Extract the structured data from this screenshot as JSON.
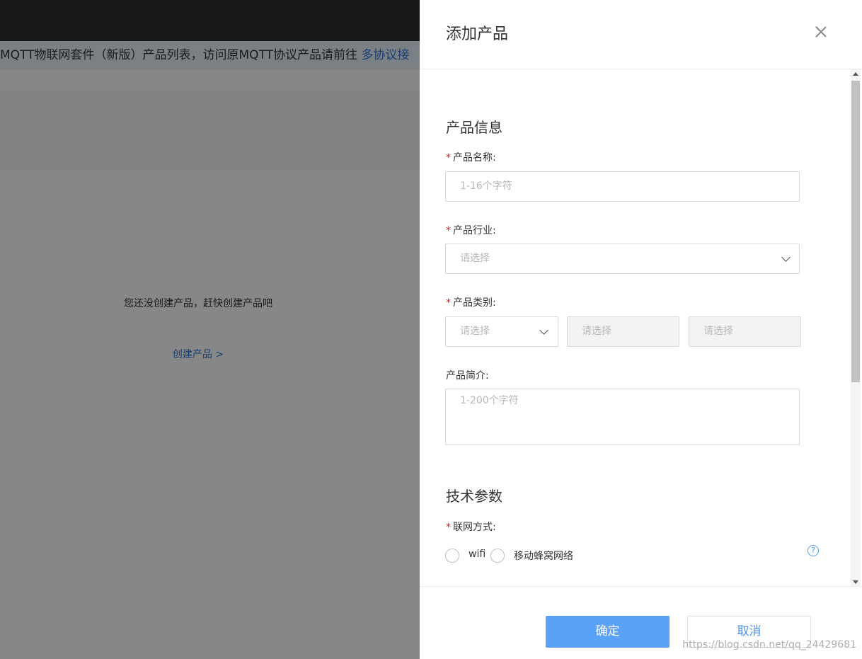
{
  "background": {
    "notice_text": "MQTT物联网套件（新版）产品列表，访问原MQTT协议产品请前往 ",
    "notice_link": "多协议接",
    "empty_text": "您还没创建产品，赶快创建产品吧",
    "create_link": "创建产品 >"
  },
  "drawer": {
    "title": "添加产品",
    "sections": {
      "info_title": "产品信息",
      "tech_title": "技术参数"
    },
    "fields": {
      "name_label": "产品名称:",
      "name_placeholder": "1-16个字符",
      "industry_label": "产品行业:",
      "industry_placeholder": "请选择",
      "category_label": "产品类别:",
      "category_placeholders": [
        "请选择",
        "请选择",
        "请选择"
      ],
      "intro_label": "产品简介:",
      "intro_placeholder": "1-200个字符",
      "network_label": "联网方式:",
      "network_options": [
        "wifi",
        "移动蜂窝网络"
      ]
    },
    "required_mark": "*",
    "help_icon_glyph": "?",
    "buttons": {
      "confirm": "确定",
      "cancel": "取消"
    }
  },
  "watermark": "https://blog.csdn.net/qq_24429681",
  "colors": {
    "accent": "#5aa2f7",
    "link": "#2f78d6",
    "required": "#e02020"
  }
}
